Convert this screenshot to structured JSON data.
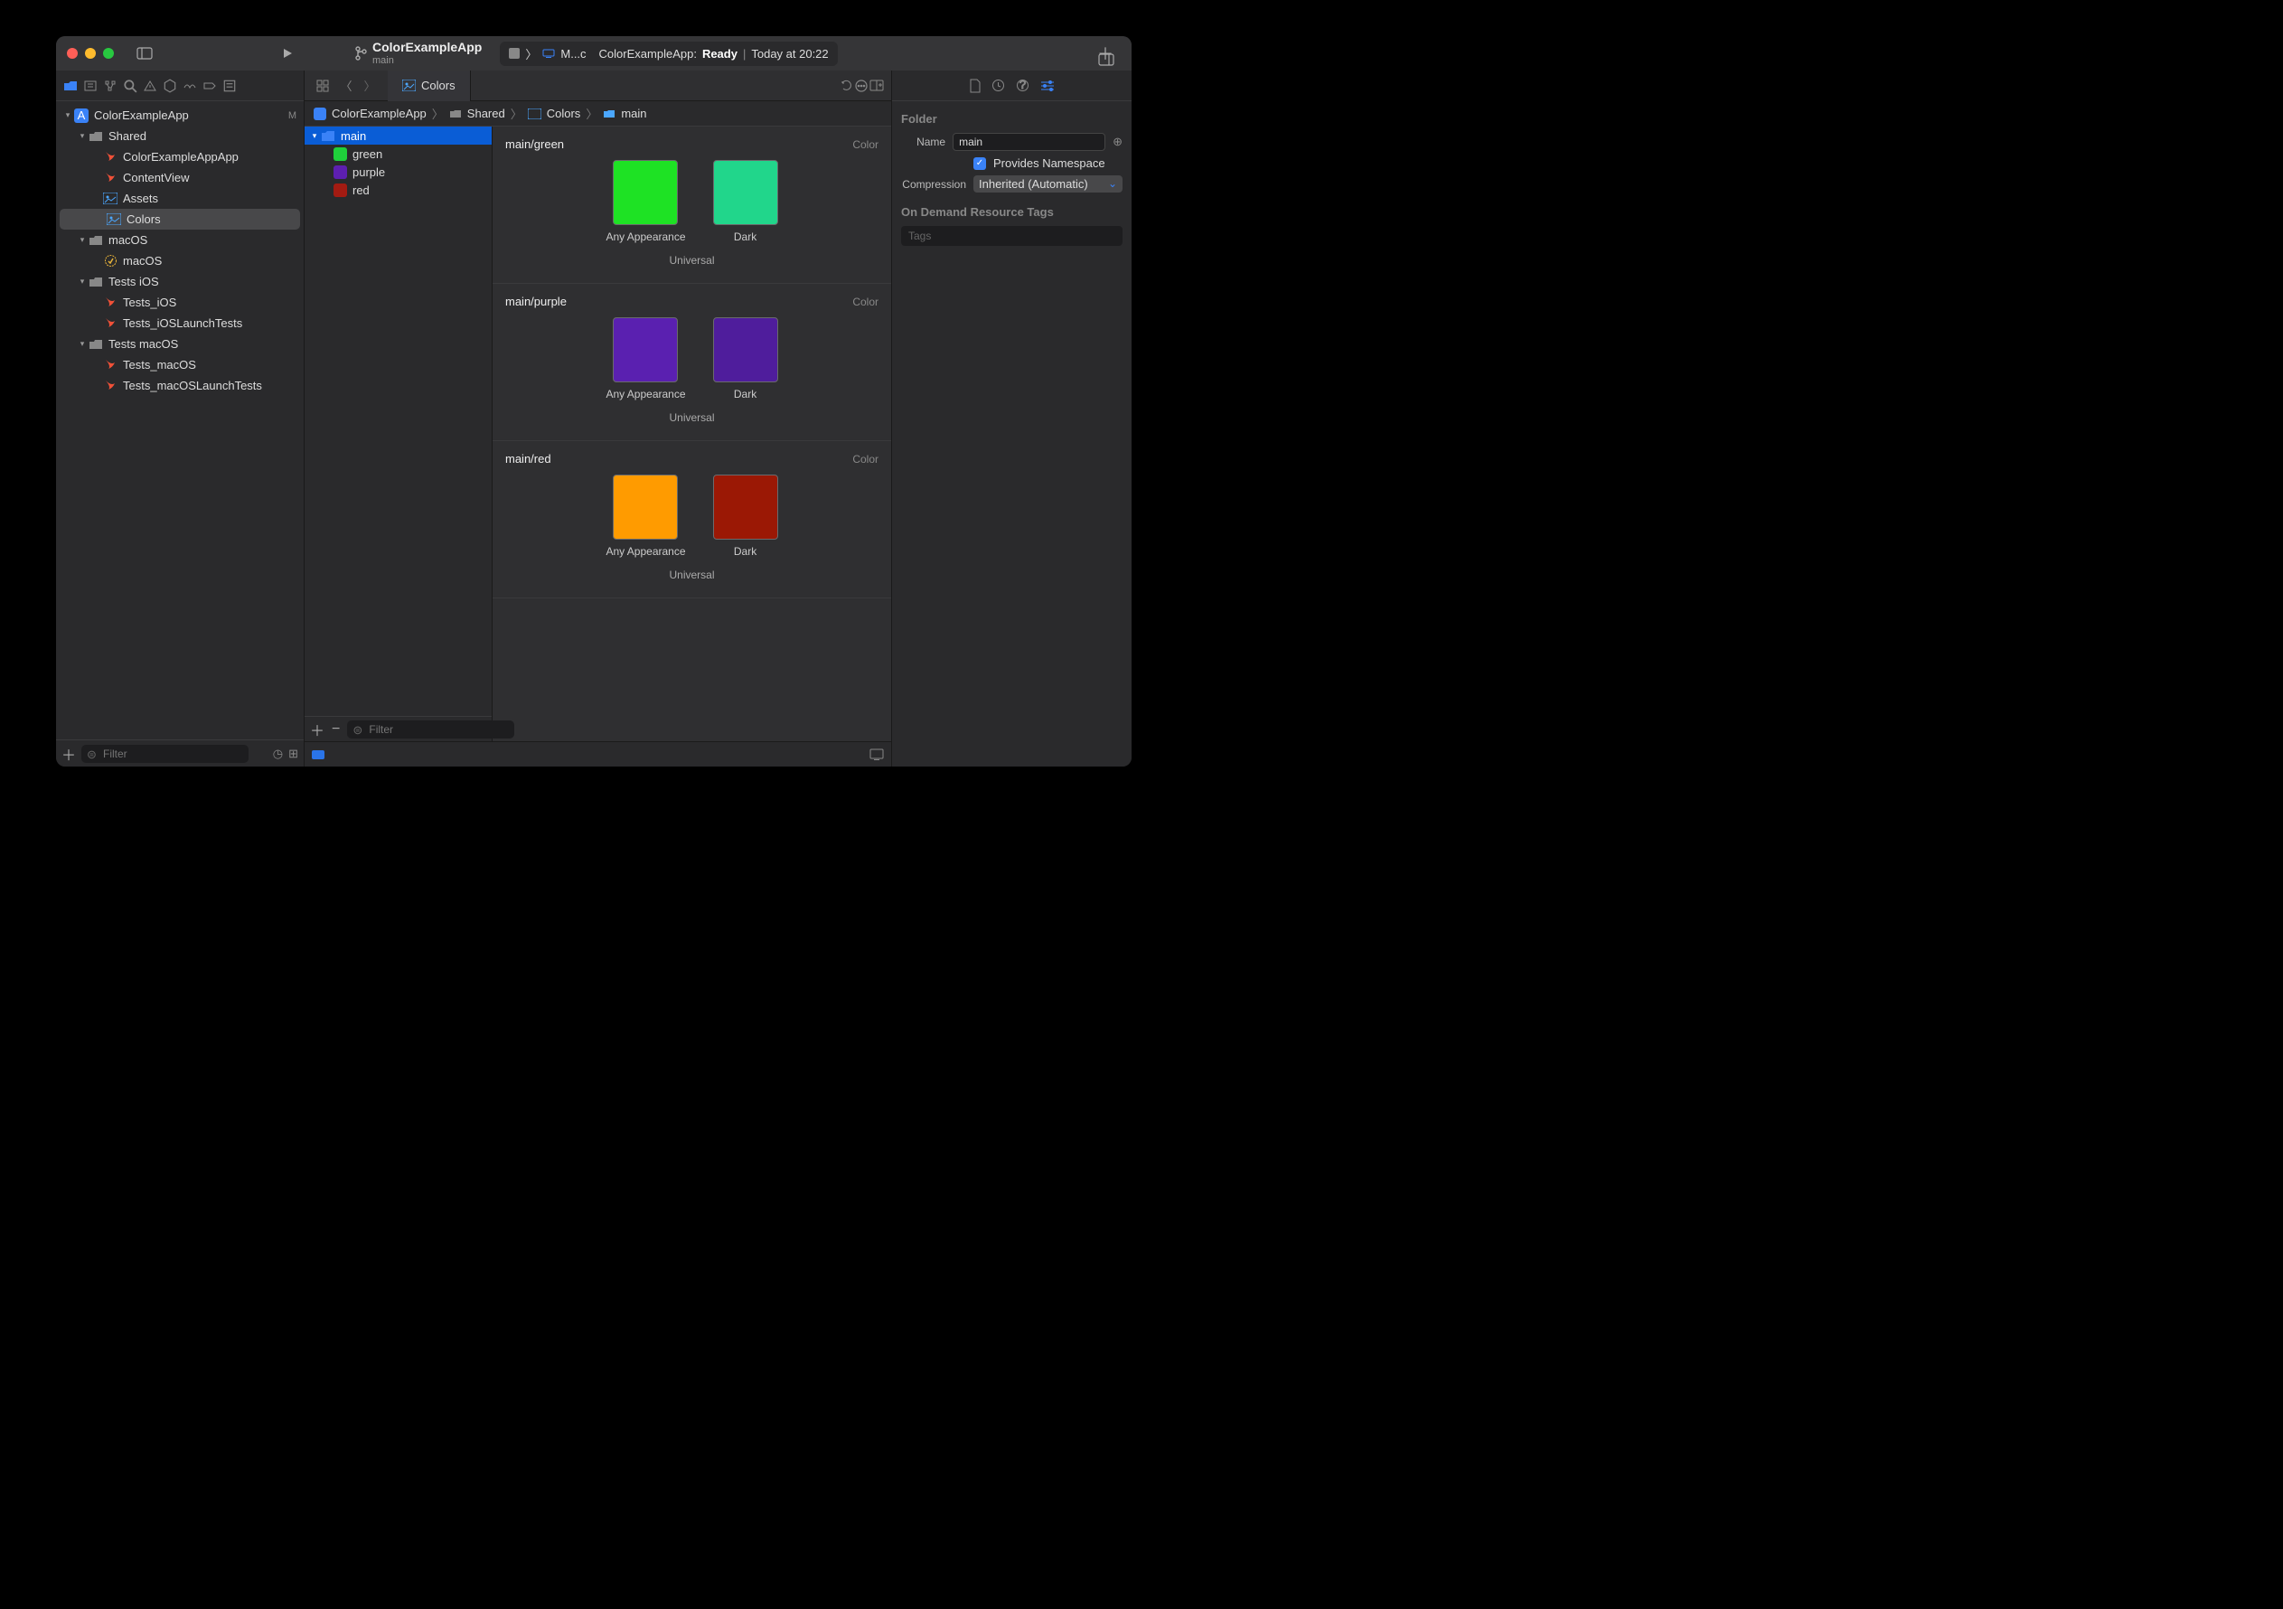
{
  "titlebar": {
    "branch_name": "ColorExampleApp",
    "branch_sub": "main",
    "scheme": "M...c",
    "status_app": "ColorExampleApp:",
    "status_state": "Ready",
    "status_time": "Today at 20:22"
  },
  "nav": {
    "project": "ColorExampleApp",
    "project_status": "M",
    "items": [
      {
        "label": "Shared",
        "icon": "folder",
        "indent": 1,
        "disc": true
      },
      {
        "label": "ColorExampleAppApp",
        "icon": "swift",
        "indent": 2
      },
      {
        "label": "ContentView",
        "icon": "swift",
        "indent": 2
      },
      {
        "label": "Assets",
        "icon": "assets",
        "indent": 2
      },
      {
        "label": "Colors",
        "icon": "assets",
        "indent": 2,
        "selected": true
      },
      {
        "label": "macOS",
        "icon": "folder",
        "indent": 1,
        "disc": true
      },
      {
        "label": "macOS",
        "icon": "badge",
        "indent": 2
      },
      {
        "label": "Tests iOS",
        "icon": "folder",
        "indent": 1,
        "disc": true
      },
      {
        "label": "Tests_iOS",
        "icon": "swift",
        "indent": 2
      },
      {
        "label": "Tests_iOSLaunchTests",
        "icon": "swift",
        "indent": 2
      },
      {
        "label": "Tests macOS",
        "icon": "folder",
        "indent": 1,
        "disc": true
      },
      {
        "label": "Tests_macOS",
        "icon": "swift",
        "indent": 2
      },
      {
        "label": "Tests_macOSLaunchTests",
        "icon": "swift",
        "indent": 2
      }
    ],
    "filter_placeholder": "Filter"
  },
  "editor": {
    "tab_label": "Colors",
    "breadcrumb": [
      "ColorExampleApp",
      "Shared",
      "Colors",
      "main"
    ],
    "outline": {
      "folder": "main",
      "items": [
        {
          "label": "green",
          "color": "#1fd03b"
        },
        {
          "label": "purple",
          "color": "#5d1fb0"
        },
        {
          "label": "red",
          "color": "#a31b12"
        }
      ],
      "filter_placeholder": "Filter"
    },
    "assets": [
      {
        "title": "main/green",
        "type": "Color",
        "any": "#1ee224",
        "dark": "#21d68b",
        "any_label": "Any Appearance",
        "dark_label": "Dark",
        "universal": "Universal"
      },
      {
        "title": "main/purple",
        "type": "Color",
        "any": "#5a20b0",
        "dark": "#4f1d9c",
        "any_label": "Any Appearance",
        "dark_label": "Dark",
        "universal": "Universal"
      },
      {
        "title": "main/red",
        "type": "Color",
        "any": "#ff9b00",
        "dark": "#9b1805",
        "any_label": "Any Appearance",
        "dark_label": "Dark",
        "universal": "Universal"
      }
    ]
  },
  "inspector": {
    "section": "Folder",
    "name_label": "Name",
    "name_value": "main",
    "namespace_label": "Provides Namespace",
    "compression_label": "Compression",
    "compression_value": "Inherited (Automatic)",
    "odr_section": "On Demand Resource Tags",
    "tags_placeholder": "Tags"
  }
}
